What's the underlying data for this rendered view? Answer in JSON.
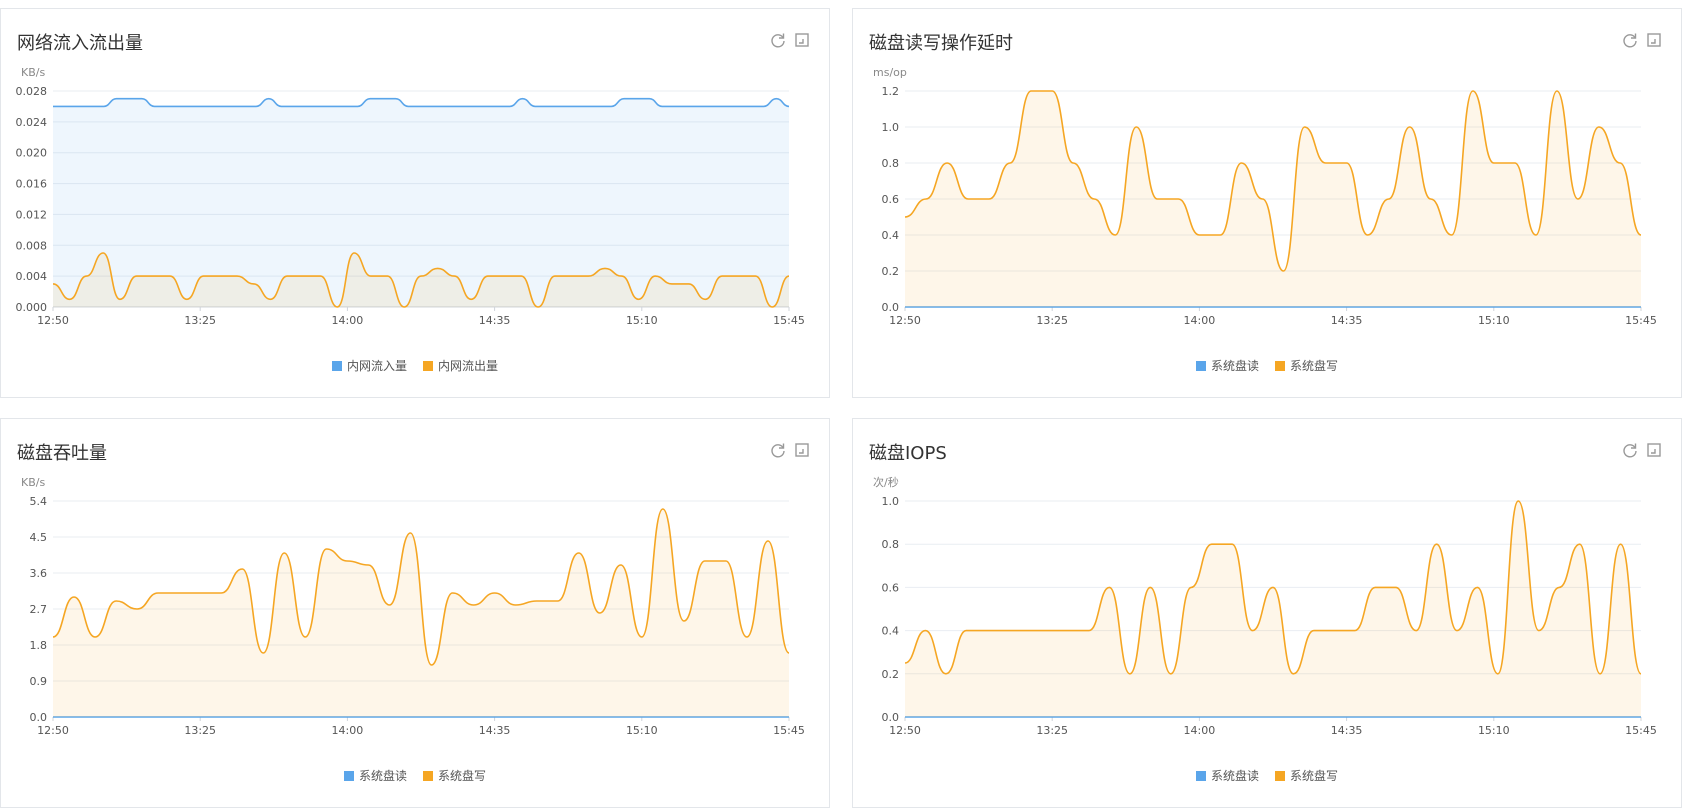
{
  "colors": {
    "blue": "#5aa5ea",
    "orange": "#f5a623",
    "grid": "#e9edf2",
    "axis": "#d0d4da",
    "text": "#555555"
  },
  "icons": {
    "refresh": "refresh-icon",
    "expand": "expand-icon"
  },
  "panels": [
    {
      "title": "网络流入流出量",
      "chart_data": {
        "type": "area",
        "title": "网络流入流出量",
        "unit": "KB/s",
        "x_ticks": [
          "12:50",
          "13:25",
          "14:00",
          "14:35",
          "15:10",
          "15:45"
        ],
        "ylim": [
          0,
          0.028
        ],
        "y_ticks": [
          "0.000",
          "0.004",
          "0.008",
          "0.012",
          "0.016",
          "0.020",
          "0.024",
          "0.028"
        ],
        "grid": true,
        "legend_position": "bottom",
        "series": [
          {
            "name": "内网流入量",
            "color": "blue",
            "values": [
              0.026,
              0.026,
              0.026,
              0.026,
              0.026,
              0.027,
              0.027,
              0.027,
              0.026,
              0.026,
              0.026,
              0.026,
              0.026,
              0.026,
              0.026,
              0.026,
              0.026,
              0.027,
              0.026,
              0.026,
              0.026,
              0.026,
              0.026,
              0.026,
              0.026,
              0.027,
              0.027,
              0.027,
              0.026,
              0.026,
              0.026,
              0.026,
              0.026,
              0.026,
              0.026,
              0.026,
              0.026,
              0.027,
              0.026,
              0.026,
              0.026,
              0.026,
              0.026,
              0.026,
              0.026,
              0.027,
              0.027,
              0.027,
              0.026,
              0.026,
              0.026,
              0.026,
              0.026,
              0.026,
              0.026,
              0.026,
              0.026,
              0.027,
              0.026
            ]
          },
          {
            "name": "内网流出量",
            "color": "orange",
            "values": [
              0.003,
              0.001,
              0.004,
              0.007,
              0.001,
              0.004,
              0.004,
              0.004,
              0.001,
              0.004,
              0.004,
              0.004,
              0.003,
              0.001,
              0.004,
              0.004,
              0.004,
              0.0,
              0.007,
              0.004,
              0.004,
              0.0,
              0.004,
              0.005,
              0.004,
              0.001,
              0.004,
              0.004,
              0.004,
              0.0,
              0.004,
              0.004,
              0.004,
              0.005,
              0.004,
              0.001,
              0.004,
              0.003,
              0.003,
              0.001,
              0.004,
              0.004,
              0.004,
              0.0,
              0.004
            ]
          }
        ]
      }
    },
    {
      "title": "磁盘读写操作延时",
      "chart_data": {
        "type": "area",
        "title": "磁盘读写操作延时",
        "unit": "ms/op",
        "x_ticks": [
          "12:50",
          "13:25",
          "14:00",
          "14:35",
          "15:10",
          "15:45"
        ],
        "ylim": [
          0,
          1.2
        ],
        "y_ticks": [
          "0.0",
          "0.2",
          "0.4",
          "0.6",
          "0.8",
          "1.0",
          "1.2"
        ],
        "grid": true,
        "legend_position": "bottom",
        "series": [
          {
            "name": "系统盘读",
            "color": "blue",
            "values": [
              0,
              0,
              0,
              0,
              0,
              0,
              0,
              0,
              0,
              0,
              0,
              0,
              0,
              0,
              0,
              0,
              0,
              0,
              0,
              0,
              0,
              0,
              0,
              0,
              0,
              0,
              0,
              0,
              0,
              0,
              0,
              0,
              0,
              0,
              0,
              0,
              0,
              0,
              0,
              0,
              0,
              0,
              0,
              0,
              0,
              0,
              0,
              0,
              0,
              0,
              0,
              0,
              0,
              0,
              0,
              0,
              0,
              0,
              0,
              0
            ]
          },
          {
            "name": "系统盘写",
            "color": "orange",
            "values": [
              0.5,
              0.6,
              0.8,
              0.6,
              0.6,
              0.8,
              1.2,
              1.2,
              0.8,
              0.6,
              0.4,
              1.0,
              0.6,
              0.6,
              0.4,
              0.4,
              0.8,
              0.6,
              0.2,
              1.0,
              0.8,
              0.8,
              0.4,
              0.6,
              1.0,
              0.6,
              0.4,
              1.2,
              0.8,
              0.8,
              0.4,
              1.2,
              0.6,
              1.0,
              0.8,
              0.4
            ]
          }
        ]
      }
    },
    {
      "title": "磁盘吞吐量",
      "chart_data": {
        "type": "area",
        "title": "磁盘吞吐量",
        "unit": "KB/s",
        "x_ticks": [
          "12:50",
          "13:25",
          "14:00",
          "14:35",
          "15:10",
          "15:45"
        ],
        "ylim": [
          0,
          5.4
        ],
        "y_ticks": [
          "0.0",
          "0.9",
          "1.8",
          "2.7",
          "3.6",
          "4.5",
          "5.4"
        ],
        "grid": true,
        "legend_position": "bottom",
        "series": [
          {
            "name": "系统盘读",
            "color": "blue",
            "values": [
              0,
              0,
              0,
              0,
              0,
              0,
              0,
              0,
              0,
              0,
              0,
              0,
              0,
              0,
              0,
              0,
              0,
              0,
              0,
              0,
              0,
              0,
              0,
              0,
              0,
              0,
              0,
              0,
              0,
              0,
              0,
              0,
              0,
              0,
              0,
              0,
              0,
              0,
              0,
              0,
              0,
              0,
              0,
              0,
              0
            ]
          },
          {
            "name": "系统盘写",
            "color": "orange",
            "values": [
              2.0,
              3.0,
              2.0,
              2.9,
              2.7,
              3.1,
              3.1,
              3.1,
              3.1,
              3.7,
              1.6,
              4.1,
              2.0,
              4.2,
              3.9,
              3.8,
              2.8,
              4.6,
              1.3,
              3.1,
              2.8,
              3.1,
              2.8,
              2.9,
              2.9,
              4.1,
              2.6,
              3.8,
              2.0,
              5.2,
              2.4,
              3.9,
              3.9,
              2.0,
              4.4,
              1.6
            ]
          }
        ]
      }
    },
    {
      "title": "磁盘IOPS",
      "chart_data": {
        "type": "area",
        "title": "磁盘IOPS",
        "unit": "次/秒",
        "x_ticks": [
          "12:50",
          "13:25",
          "14:00",
          "14:35",
          "15:10",
          "15:45"
        ],
        "ylim": [
          0,
          1.0
        ],
        "y_ticks": [
          "0.0",
          "0.2",
          "0.4",
          "0.6",
          "0.8",
          "1.0"
        ],
        "grid": true,
        "legend_position": "bottom",
        "series": [
          {
            "name": "系统盘读",
            "color": "blue",
            "values": [
              0,
              0,
              0,
              0,
              0,
              0,
              0,
              0,
              0,
              0,
              0,
              0,
              0,
              0,
              0,
              0,
              0,
              0,
              0,
              0,
              0,
              0,
              0,
              0,
              0,
              0,
              0,
              0,
              0,
              0,
              0,
              0,
              0,
              0,
              0,
              0,
              0,
              0,
              0,
              0,
              0,
              0,
              0,
              0,
              0
            ]
          },
          {
            "name": "系统盘写",
            "color": "orange",
            "values": [
              0.25,
              0.4,
              0.2,
              0.4,
              0.4,
              0.4,
              0.4,
              0.4,
              0.4,
              0.4,
              0.6,
              0.2,
              0.6,
              0.2,
              0.6,
              0.8,
              0.8,
              0.4,
              0.6,
              0.2,
              0.4,
              0.4,
              0.4,
              0.6,
              0.6,
              0.4,
              0.8,
              0.4,
              0.6,
              0.2,
              1.0,
              0.4,
              0.6,
              0.8,
              0.2,
              0.8,
              0.2
            ]
          }
        ]
      }
    }
  ]
}
